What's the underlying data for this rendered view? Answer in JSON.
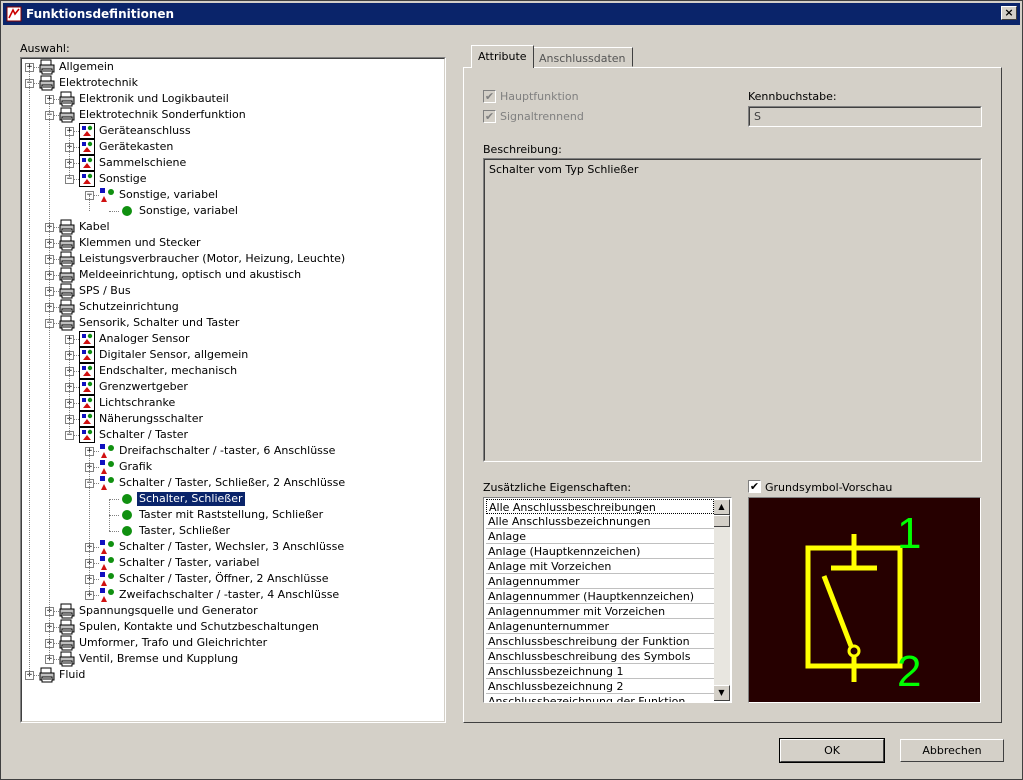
{
  "window": {
    "title": "Funktionsdefinitionen",
    "close_label": "×"
  },
  "left": {
    "label": "Auswahl:",
    "tree": [
      {
        "label": "Allgemein",
        "level": 0,
        "icon": "tree-printer-icon",
        "expander": "+"
      },
      {
        "label": "Elektrotechnik",
        "level": 0,
        "icon": "tree-printer-icon",
        "expander": "−"
      },
      {
        "label": "Elektronik und Logikbauteil",
        "level": 1,
        "icon": "tree-printer-icon",
        "expander": "+"
      },
      {
        "label": "Elektrotechnik Sonderfunktion",
        "level": 1,
        "icon": "tree-printer-icon",
        "expander": "−"
      },
      {
        "label": "Geräteanschluss",
        "level": 2,
        "icon": "symbol-box-icon",
        "expander": "+"
      },
      {
        "label": "Gerätekasten",
        "level": 2,
        "icon": "symbol-box-icon",
        "expander": "+"
      },
      {
        "label": "Sammelschiene",
        "level": 2,
        "icon": "symbol-box-icon",
        "expander": "+"
      },
      {
        "label": "Sonstige",
        "level": 2,
        "icon": "symbol-box-icon",
        "expander": "−"
      },
      {
        "label": "Sonstige, variabel",
        "level": 3,
        "icon": "shapes-icon",
        "expander": "−"
      },
      {
        "label": "Sonstige, variabel",
        "level": 4,
        "icon": "green-dot-icon",
        "expander": ""
      },
      {
        "label": "Kabel",
        "level": 1,
        "icon": "tree-printer-icon",
        "expander": "+"
      },
      {
        "label": "Klemmen und Stecker",
        "level": 1,
        "icon": "tree-printer-icon",
        "expander": "+"
      },
      {
        "label": "Leistungsverbraucher (Motor, Heizung, Leuchte)",
        "level": 1,
        "icon": "tree-printer-icon",
        "expander": "+"
      },
      {
        "label": "Meldeeinrichtung, optisch und akustisch",
        "level": 1,
        "icon": "tree-printer-icon",
        "expander": "+"
      },
      {
        "label": "SPS / Bus",
        "level": 1,
        "icon": "tree-printer-icon",
        "expander": "+"
      },
      {
        "label": "Schutzeinrichtung",
        "level": 1,
        "icon": "tree-printer-icon",
        "expander": "+"
      },
      {
        "label": "Sensorik, Schalter und Taster",
        "level": 1,
        "icon": "tree-printer-icon",
        "expander": "−"
      },
      {
        "label": "Analoger Sensor",
        "level": 2,
        "icon": "symbol-box-icon",
        "expander": "+"
      },
      {
        "label": "Digitaler Sensor, allgemein",
        "level": 2,
        "icon": "symbol-box-icon",
        "expander": "+"
      },
      {
        "label": "Endschalter, mechanisch",
        "level": 2,
        "icon": "symbol-box-icon",
        "expander": "+"
      },
      {
        "label": "Grenzwertgeber",
        "level": 2,
        "icon": "symbol-box-icon",
        "expander": "+"
      },
      {
        "label": "Lichtschranke",
        "level": 2,
        "icon": "symbol-box-icon",
        "expander": "+"
      },
      {
        "label": "Näherungsschalter",
        "level": 2,
        "icon": "symbol-box-icon",
        "expander": "+"
      },
      {
        "label": "Schalter / Taster",
        "level": 2,
        "icon": "symbol-box-icon",
        "expander": "−"
      },
      {
        "label": "Dreifachschalter / -taster, 6 Anschlüsse",
        "level": 3,
        "icon": "shapes-icon",
        "expander": "+"
      },
      {
        "label": "Grafik",
        "level": 3,
        "icon": "shapes-icon",
        "expander": "+"
      },
      {
        "label": "Schalter / Taster, Schließer, 2 Anschlüsse",
        "level": 3,
        "icon": "shapes-icon",
        "expander": "−"
      },
      {
        "label": "Schalter, Schließer",
        "level": 4,
        "icon": "green-dot-icon",
        "expander": "",
        "selected": true
      },
      {
        "label": "Taster mit Raststellung, Schließer",
        "level": 4,
        "icon": "green-dot-icon",
        "expander": ""
      },
      {
        "label": "Taster, Schließer",
        "level": 4,
        "icon": "green-dot-icon",
        "expander": ""
      },
      {
        "label": "Schalter / Taster, Wechsler, 3 Anschlüsse",
        "level": 3,
        "icon": "shapes-icon",
        "expander": "+"
      },
      {
        "label": "Schalter / Taster, variabel",
        "level": 3,
        "icon": "shapes-icon",
        "expander": "+"
      },
      {
        "label": "Schalter / Taster, Öffner, 2 Anschlüsse",
        "level": 3,
        "icon": "shapes-icon",
        "expander": "+"
      },
      {
        "label": "Zweifachschalter / -taster, 4 Anschlüsse",
        "level": 3,
        "icon": "shapes-icon",
        "expander": "+"
      },
      {
        "label": "Spannungsquelle und Generator",
        "level": 1,
        "icon": "tree-printer-icon",
        "expander": "+"
      },
      {
        "label": "Spulen, Kontakte und Schutzbeschaltungen",
        "level": 1,
        "icon": "tree-printer-icon",
        "expander": "+"
      },
      {
        "label": "Umformer, Trafo und Gleichrichter",
        "level": 1,
        "icon": "tree-printer-icon",
        "expander": "+"
      },
      {
        "label": "Ventil, Bremse und Kupplung",
        "level": 1,
        "icon": "tree-printer-icon",
        "expander": "+"
      },
      {
        "label": "Fluid",
        "level": 0,
        "icon": "tree-printer-icon",
        "expander": "+"
      }
    ]
  },
  "tabs": [
    {
      "label": "Attribute",
      "active": true
    },
    {
      "label": "Anschlussdaten",
      "active": false
    }
  ],
  "attributes": {
    "hauptfunktion_label": "Hauptfunktion",
    "hauptfunktion_checked": true,
    "signaltrennend_label": "Signaltrennend",
    "signaltrennend_checked": true,
    "kennbuchstabe_label": "Kennbuchstabe:",
    "kennbuchstabe_value": "S",
    "beschreibung_label": "Beschreibung:",
    "beschreibung_value": "Schalter vom Typ Schließer",
    "zusatz_label": "Zusätzliche Eigenschaften:",
    "zusatz_items": [
      "Alle Anschlussbeschreibungen",
      "Alle Anschlussbezeichnungen",
      "Anlage",
      "Anlage (Hauptkennzeichen)",
      "Anlage mit Vorzeichen",
      "Anlagennummer",
      "Anlagennummer (Hauptkennzeichen)",
      "Anlagennummer mit Vorzeichen",
      "Anlagenunternummer",
      "Anschlussbeschreibung der Funktion",
      "Anschlussbeschreibung des Symbols",
      "Anschlussbezeichnung 1",
      "Anschlussbezeichnung 2",
      "Anschlussbezeichnung der Funktion"
    ],
    "preview_label": "Grundsymbol-Vorschau",
    "preview_checked": true,
    "preview_pin_1": "1",
    "preview_pin_2": "2"
  },
  "buttons": {
    "ok": "OK",
    "cancel": "Abbrechen"
  },
  "colors": {
    "preview_bg": "#260000",
    "symbol": "#ffff00",
    "pin_label": "#00ff00",
    "selection": "#0a246a"
  }
}
